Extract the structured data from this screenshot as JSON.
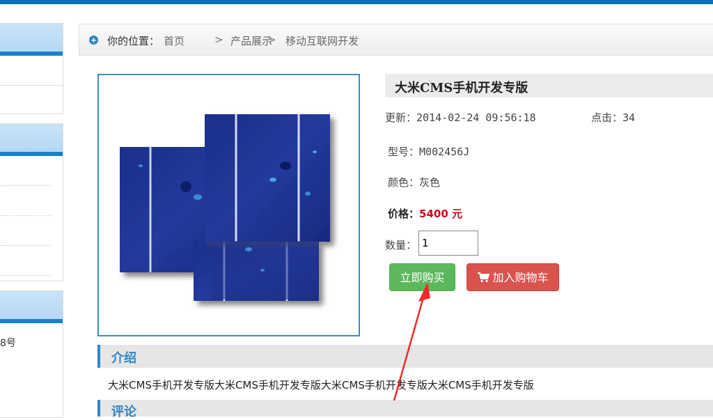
{
  "breadcrumb": {
    "label": "你的位置：",
    "items": [
      "首页",
      "产品展示",
      "移动互联网开发"
    ],
    "separator": ">"
  },
  "sidebar": {
    "partial_text": "8号"
  },
  "product": {
    "title": "大米CMS手机开发专版",
    "updated_label": "更新：",
    "updated_value": "2014-02-24 09:56:18",
    "clicks_label": "点击：",
    "clicks_value": "34",
    "model_label": "型号：",
    "model_value": "M002456J",
    "color_label": "颜色：",
    "color_value": "灰色",
    "price_label": "价格：",
    "price_value": "5400 元",
    "qty_label": "数量：",
    "qty_value": "1",
    "buy_label": "立即购买",
    "cart_label": "加入购物车"
  },
  "sections": {
    "intro_title": "介绍",
    "intro_text": "大米CMS手机开发专版大米CMS手机开发专版大米CMS手机开发专版大米CMS手机开发专版",
    "comment_title": "评论"
  },
  "colors": {
    "accent": "#2f86c5",
    "buy": "#5cb85c",
    "cart": "#d9534f",
    "price": "#d0021b",
    "annotation_arrow": "#ee2b2b"
  }
}
